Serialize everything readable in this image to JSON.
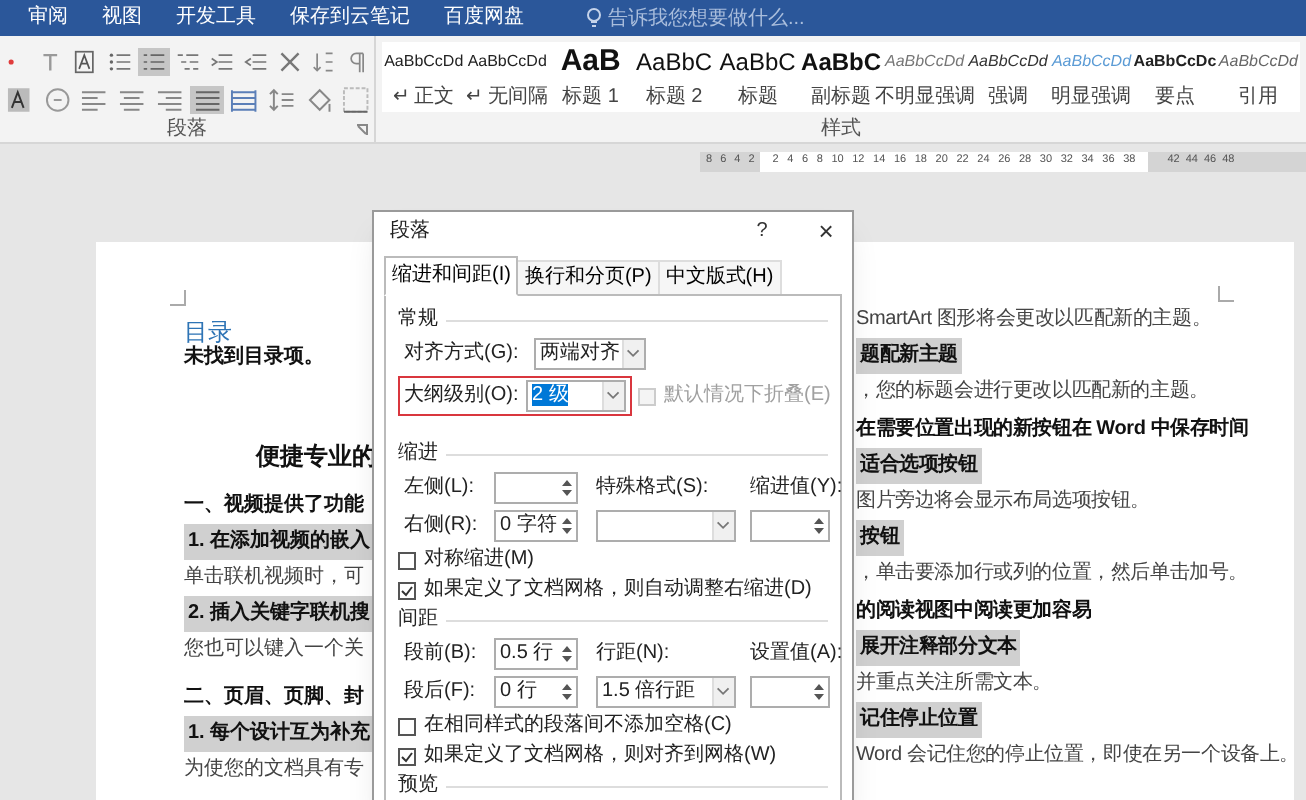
{
  "ribbon_tabs": [
    "审阅",
    "视图",
    "开发工具",
    "保存到云笔记",
    "百度网盘"
  ],
  "search": {
    "placeholder": "告诉我您想要做什么..."
  },
  "paragraph_group": {
    "label": "段落",
    "tools_top": [
      {
        "kind": "dot",
        "selected": false
      },
      {
        "kind": "text-effect",
        "selected": false
      },
      {
        "kind": "char-border",
        "selected": false
      },
      {
        "kind": "bullets",
        "selected": false
      },
      {
        "kind": "numbering",
        "selected": true
      },
      {
        "kind": "multilevel",
        "selected": false
      },
      {
        "kind": "outdent",
        "selected": false
      },
      {
        "kind": "indent",
        "selected": false
      },
      {
        "kind": "asian-layout",
        "selected": false
      },
      {
        "kind": "sort",
        "selected": false
      },
      {
        "kind": "marks",
        "selected": false
      }
    ],
    "tools_bottom": [
      {
        "kind": "char-shading",
        "selected": false
      },
      {
        "kind": "enclosed",
        "selected": false
      },
      {
        "kind": "align-left",
        "selected": false
      },
      {
        "kind": "align-center",
        "selected": false
      },
      {
        "kind": "align-right",
        "selected": false
      },
      {
        "kind": "justify",
        "selected": true
      },
      {
        "kind": "distributed",
        "selected": false
      },
      {
        "kind": "line-spacing",
        "selected": false
      },
      {
        "kind": "shading",
        "selected": false
      },
      {
        "kind": "borders",
        "selected": false
      }
    ]
  },
  "styles": [
    {
      "preview": "AaBbCcDd",
      "name": "↵ 正文",
      "kind": "normal"
    },
    {
      "preview": "AaBbCcDd",
      "name": "↵ 无间隔",
      "kind": "normal"
    },
    {
      "preview": "AaB",
      "name": "标题 1",
      "kind": "heading1"
    },
    {
      "preview": "AaBbC",
      "name": "标题 2",
      "kind": "heading2"
    },
    {
      "preview": "AaBbC",
      "name": "标题",
      "kind": "title"
    },
    {
      "preview": "AaBbC",
      "name": "副标题",
      "kind": "subtitle"
    },
    {
      "preview": "AaBbCcDd",
      "name": "不明显强调",
      "kind": "subtle"
    },
    {
      "preview": "AaBbCcDd",
      "name": "强调",
      "kind": "emphasis"
    },
    {
      "preview": "AaBbCcDd",
      "name": "明显强调",
      "kind": "intense"
    },
    {
      "preview": "AaBbCcDc",
      "name": "要点",
      "kind": "strong"
    },
    {
      "preview": "AaBbCcDd",
      "name": "引用",
      "kind": "quote"
    }
  ],
  "styles_group": {
    "label": "样式"
  },
  "ruler": {
    "left_numbers": [
      "8",
      "6",
      "4",
      "2"
    ],
    "numbers": [
      "2",
      "4",
      "6",
      "8",
      "10",
      "12",
      "14",
      "16",
      "18",
      "20",
      "22",
      "24",
      "26",
      "28",
      "30",
      "32",
      "34",
      "36",
      "38"
    ],
    "right_numbers": [
      "42",
      "44",
      "46",
      "48"
    ]
  },
  "document": {
    "left": [
      {
        "kind": "toc-title",
        "text": "目录"
      },
      {
        "kind": "toc-note",
        "text": "未找到目录项。"
      },
      {
        "kind": "title",
        "text": "便捷专业的"
      },
      {
        "kind": "h1",
        "text": "一、视频提供了功能"
      },
      {
        "kind": "h2",
        "text": "1. 在添加视频的嵌入"
      },
      {
        "kind": "body",
        "text": "单击联机视频时，可"
      },
      {
        "kind": "h2",
        "text": "2. 插入关键字联机搜"
      },
      {
        "kind": "body",
        "text": "您也可以键入一个关"
      },
      {
        "kind": "h1",
        "text": "二、页眉、页脚、封"
      },
      {
        "kind": "h2",
        "text": "1. 每个设计互为补充"
      },
      {
        "kind": "body",
        "text": "为使您的文档具有专"
      }
    ],
    "right": [
      {
        "kind": "body",
        "text": "SmartArt 图形将会更改以匹配新的主题。"
      },
      {
        "kind": "h2",
        "text": "题配新主题"
      },
      {
        "kind": "body",
        "text": "，您的标题会进行更改以匹配新的主题。"
      },
      {
        "kind": "h1",
        "text": "在需要位置出现的新按钮在 Word 中保存时间"
      },
      {
        "kind": "h2",
        "text": "适合选项按钮"
      },
      {
        "kind": "body",
        "text": "图片旁边将会显示布局选项按钮。"
      },
      {
        "kind": "h2",
        "text": "按钮"
      },
      {
        "kind": "body",
        "text": "，单击要添加行或列的位置，然后单击加号。"
      },
      {
        "kind": "h1",
        "text": "的阅读视图中阅读更加容易"
      },
      {
        "kind": "h2",
        "text": "展开注释部分文本"
      },
      {
        "kind": "body",
        "text": "并重点关注所需文本。"
      },
      {
        "kind": "h2",
        "text": "记住停止位置"
      },
      {
        "kind": "body",
        "text": "Word 会记住您的停止位置，即使在另一个设备上。"
      }
    ]
  },
  "dialog": {
    "title": "段落",
    "help": "?",
    "close": "×",
    "tabs": [
      {
        "label": "缩进和间距(I)",
        "selected": true
      },
      {
        "label": "换行和分页(P)",
        "selected": false
      },
      {
        "label": "中文版式(H)",
        "selected": false
      }
    ],
    "general": {
      "heading": "常规",
      "alignment": {
        "label": "对齐方式(G):",
        "value": "两端对齐"
      },
      "outline_level": {
        "label": "大纲级别(O):",
        "value": "2 级",
        "value_selected": true,
        "marked": true
      },
      "collapse": {
        "label": "默认情况下折叠(E)",
        "checked": false,
        "disabled": true
      }
    },
    "indent": {
      "heading": "缩进",
      "left": {
        "label": "左侧(L):"
      },
      "right": {
        "label": "右侧(R):",
        "value": "0 字符"
      },
      "special": {
        "label": "特殊格式(S):"
      },
      "by": {
        "label": "缩进值(Y):"
      },
      "checkboxes": [
        {
          "label": "对称缩进(M)",
          "checked": false
        },
        {
          "label": "如果定义了文档网格，则自动调整右缩进(D)",
          "checked": true
        }
      ]
    },
    "spacing": {
      "heading": "间距",
      "before": {
        "label": "段前(B):",
        "value": "0.5 行"
      },
      "after": {
        "label": "段后(F):",
        "value": "0 行"
      },
      "line_spacing": {
        "label": "行距(N):",
        "value": "1.5 倍行距"
      },
      "at": {
        "label": "设置值(A):"
      },
      "checkboxes": [
        {
          "label": "在相同样式的段落间不添加空格(C)",
          "checked": false
        },
        {
          "label": "如果定义了文档网格，则对齐到网格(W)",
          "checked": true
        }
      ]
    },
    "preview": {
      "heading": "预览"
    }
  }
}
